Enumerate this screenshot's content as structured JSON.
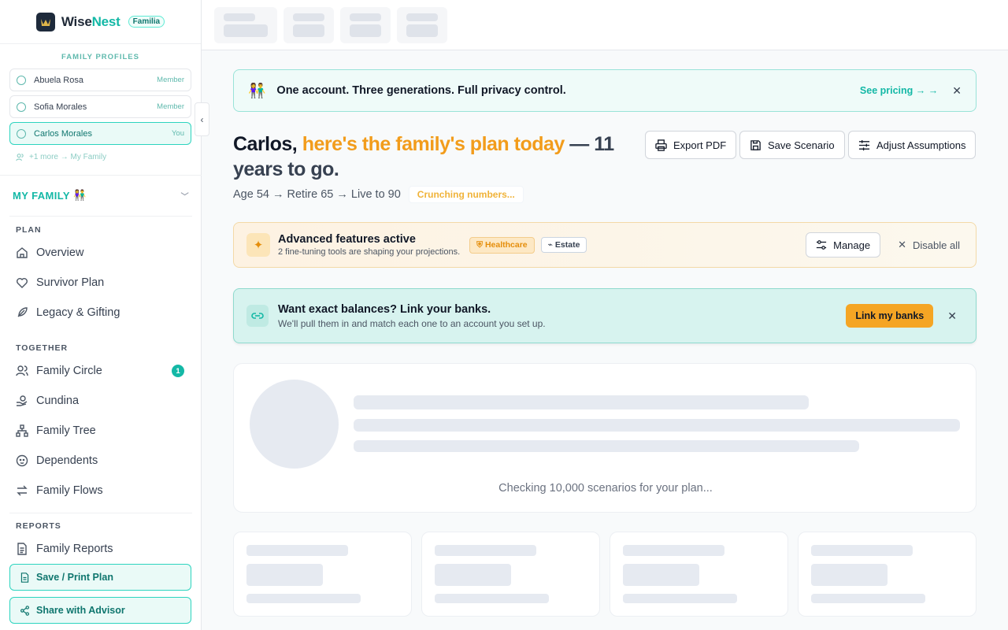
{
  "brand": {
    "name_a": "Wise",
    "name_b": "Nest",
    "badge": "Familia"
  },
  "profiles": {
    "title": "FAMILY PROFILES",
    "items": [
      {
        "name": "Abuela Rosa",
        "role": "Member"
      },
      {
        "name": "Sofia Morales",
        "role": "Member"
      },
      {
        "name": "Carlos Morales",
        "role": "You"
      }
    ],
    "more": "+1 more → My Family"
  },
  "my_family": {
    "label": "MY FAMILY",
    "emoji": "👫"
  },
  "nav": {
    "plan_label": "PLAN",
    "plan": [
      "Overview",
      "Survivor Plan",
      "Legacy & Gifting"
    ],
    "together_label": "TOGETHER",
    "together": [
      "Family Circle",
      "Cundina",
      "Family Tree",
      "Dependents",
      "Family Flows"
    ],
    "family_circle_count": "1",
    "reports_label": "REPORTS",
    "reports": [
      "Family Reports"
    ]
  },
  "sidebar_buttons": {
    "save": "Save / Print Plan",
    "share": "Share with Advisor"
  },
  "banner": {
    "emoji": "👫",
    "message": "One account. Three generations. Full privacy control.",
    "link": "See pricing → →"
  },
  "heading": {
    "name": "Carlos, ",
    "accent": "here's the family's plan today",
    "tail": " — 11 years to go."
  },
  "subline": {
    "text": "Age 54 → Retire 65 → Live to 90",
    "status": "Crunching numbers..."
  },
  "actions": {
    "export": "Export PDF",
    "save": "Save Scenario",
    "adjust": "Adjust Assumptions"
  },
  "advanced": {
    "title": "Advanced features active",
    "subtitle": "2 fine-tuning tools are shaping your projections.",
    "chip_health": "Healthcare",
    "chip_estate": "Estate",
    "manage": "Manage",
    "disable": "Disable all"
  },
  "link_banks": {
    "title": "Want exact balances? Link your banks.",
    "subtitle": "We'll pull them in and match each one to an account you set up.",
    "button": "Link my banks"
  },
  "loading": {
    "caption": "Checking 10,000 scenarios for your plan..."
  },
  "colors": {
    "accent_teal": "#14b8a6",
    "accent_orange": "#f29c1b",
    "button_orange": "#f5a524"
  }
}
